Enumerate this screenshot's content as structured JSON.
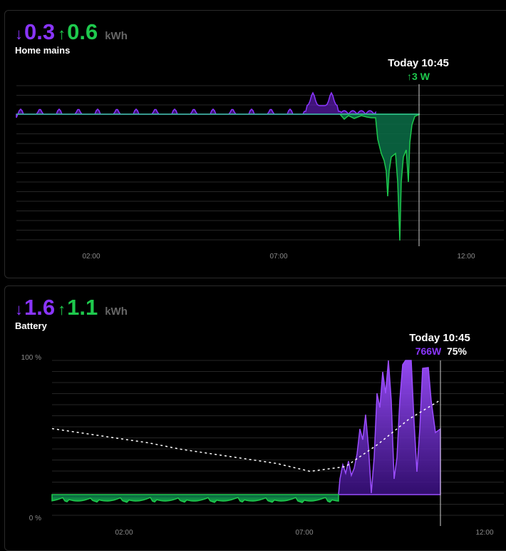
{
  "mains": {
    "title": "Home mains",
    "import_arrow": "↓",
    "import_value": "0.3",
    "export_arrow": "↑",
    "export_value": "0.6",
    "unit": "kWh",
    "tooltip": {
      "time": "Today 10:45",
      "value": "↑3 W"
    },
    "x_ticks": [
      "02:00",
      "07:00",
      "12:00"
    ],
    "colors": {
      "import": "#8a35ff",
      "export": "#1ec94d"
    }
  },
  "battery": {
    "title": "Battery",
    "discharge_arrow": "↓",
    "discharge_value": "1.6",
    "charge_arrow": "↑",
    "charge_value": "1.1",
    "unit": "kWh",
    "tooltip": {
      "time": "Today 10:45",
      "power": "766W",
      "soc": "75%"
    },
    "y_ticks": [
      "100 %",
      "0 %"
    ],
    "x_ticks": [
      "02:00",
      "07:00",
      "12:00"
    ],
    "colors": {
      "discharge": "#8a35ff",
      "charge": "#1ec94d",
      "soc": "#ffffff"
    }
  },
  "chart_data": [
    {
      "type": "area",
      "title": "Home mains",
      "x_ticks": [
        "02:00",
        "07:00",
        "12:00"
      ],
      "series": [],
      "tooltip": {
        "time": "Today 10:45",
        "value": "↑3 W"
      }
    },
    {
      "type": "area",
      "title": "Battery",
      "y_ticks": [
        "0 %",
        "100 %"
      ],
      "ylim": [
        0,
        100
      ],
      "x_ticks": [
        "02:00",
        "07:00",
        "12:00"
      ],
      "soc_percent": {
        "x": [
          "00:00",
          "01:00",
          "02:00",
          "03:00",
          "04:00",
          "05:00",
          "06:00",
          "07:00",
          "07:45",
          "08:30",
          "09:15",
          "10:00",
          "10:45"
        ],
        "values": [
          57,
          54,
          51,
          48,
          44,
          41,
          38,
          35,
          30,
          33,
          47,
          63,
          75
        ]
      },
      "tooltip": {
        "time": "Today 10:45",
        "power": "766W",
        "soc": "75%"
      }
    }
  ]
}
